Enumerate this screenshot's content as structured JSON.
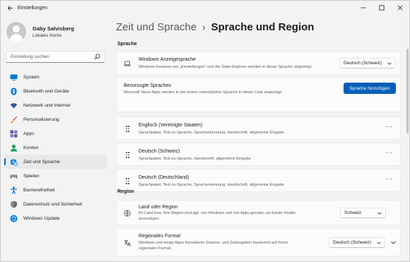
{
  "window": {
    "app_title": "Einstellungen",
    "back_icon": "back-arrow-icon",
    "controls": [
      "minimize-icon",
      "maximize-icon",
      "close-icon"
    ]
  },
  "profile": {
    "name": "Gaby Salvisberg",
    "account": "Lokales Konto"
  },
  "search": {
    "placeholder": "Einstellung suchen"
  },
  "nav": [
    {
      "label": "System",
      "icon": "monitor-icon",
      "color": "#0078d4"
    },
    {
      "label": "Bluetooth und Geräte",
      "icon": "bluetooth-icon",
      "color": "#0078d4"
    },
    {
      "label": "Netzwerk und Internet",
      "icon": "wifi-icon",
      "color": "#2b5797"
    },
    {
      "label": "Personalisierung",
      "icon": "brush-icon",
      "color": "#c7511f"
    },
    {
      "label": "Apps",
      "icon": "apps-icon",
      "color": "#5c5c9c"
    },
    {
      "label": "Konten",
      "icon": "person-icon",
      "color": "#1f9f5f"
    },
    {
      "label": "Zeit und Sprache",
      "icon": "globe-clock-icon",
      "color": "#0078d4",
      "active": true
    },
    {
      "label": "Spielen",
      "icon": "gamepad-icon",
      "color": "#7a7a7a"
    },
    {
      "label": "Barrierefreiheit",
      "icon": "accessibility-icon",
      "color": "#0063b1"
    },
    {
      "label": "Datenschutz und Sicherheit",
      "icon": "shield-icon",
      "color": "#6b6b6b"
    },
    {
      "label": "Windows Update",
      "icon": "update-icon",
      "color": "#0078d4"
    }
  ],
  "header": {
    "parent": "Zeit und Sprache",
    "separator": "›",
    "current": "Sprache und Region"
  },
  "language_section": {
    "title": "Sprache",
    "display_language": {
      "title": "Windows-Anzeigesprache",
      "subtitle": "Windows-Features wie „Einstellungen“ und der Datei-Explorer werden in dieser Sprache angezeigt.",
      "value": "Deutsch (Schweiz)"
    },
    "preferred": {
      "title": "Bevorzugte Sprachen",
      "subtitle": "Microsoft Store-Apps werden in der ersten unterstützten Sprache in dieser Liste angezeigt.",
      "button": "Sprache hinzufügen"
    },
    "languages": [
      {
        "name": "Englisch (Vereinigte Staaten)",
        "features": "Sprachpaket, Text-zu-Sprache, Spracherkennung, Handschrift, allgemeine Eingabe"
      },
      {
        "name": "Deutsch (Schweiz)",
        "features": "Sprachpaket, Text-zu-Sprache, Handschrift, allgemeine Eingabe"
      },
      {
        "name": "Deutsch (Deutschland)",
        "features": "Sprachpaket, Text-zu-Sprache, Spracherkennung, Handschrift, allgemeine Eingabe"
      }
    ],
    "more_label": "···"
  },
  "region_section": {
    "title": "Region",
    "country": {
      "title": "Land oder Region",
      "subtitle_line1": "Ihr Land bzw. Ihre Region wird ggf. von Windows und von Apps genutzt, um lokale Inhalte",
      "subtitle_line2": "anzuzeigen.",
      "value": "Schweiz"
    },
    "format": {
      "title": "Regionales Format",
      "subtitle_line1": "Windows und einige Apps formatieren Datums- und Zeitangaben basierend auf ihrem",
      "subtitle_line2": "regionalen Format.",
      "value": "Deutsch (Schweiz)"
    }
  },
  "colors": {
    "accent": "#005fb8",
    "background": "#f3f3f3",
    "card": "#fbfbfb"
  }
}
